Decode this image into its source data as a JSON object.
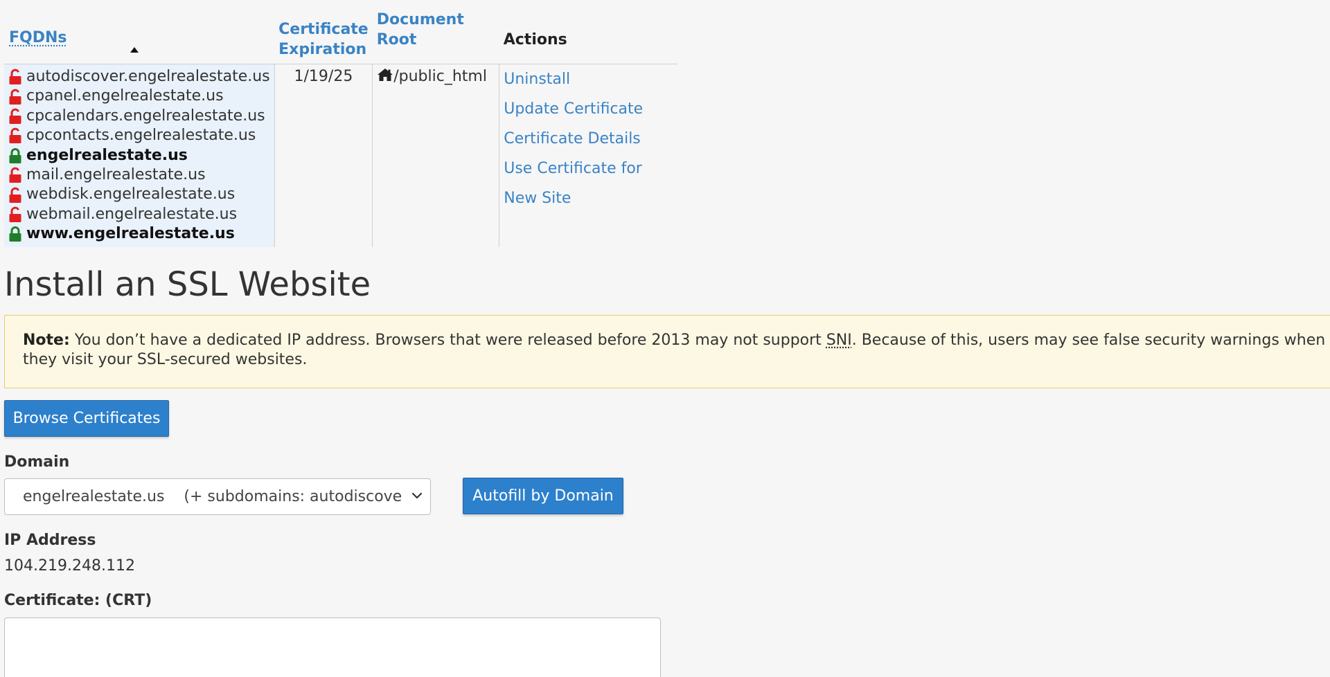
{
  "table": {
    "headers": {
      "fqdns": "FQDNs",
      "cert_expiration_line1": "Certificate",
      "cert_expiration_line2": "Expiration",
      "document_root": "Document Root",
      "actions": "Actions"
    },
    "row": {
      "fqdns": [
        {
          "name": "autodiscover.engelrealestate.us",
          "secure": false
        },
        {
          "name": "cpanel.engelrealestate.us",
          "secure": false
        },
        {
          "name": "cpcalendars.engelrealestate.us",
          "secure": false
        },
        {
          "name": "cpcontacts.engelrealestate.us",
          "secure": false
        },
        {
          "name": "engelrealestate.us",
          "secure": true
        },
        {
          "name": "mail.engelrealestate.us",
          "secure": false
        },
        {
          "name": "webdisk.engelrealestate.us",
          "secure": false
        },
        {
          "name": "webmail.engelrealestate.us",
          "secure": false
        },
        {
          "name": "www.engelrealestate.us",
          "secure": true
        }
      ],
      "expiration": "1/19/25",
      "document_root": "/public_html",
      "actions": [
        "Uninstall",
        "Update Certificate",
        "Certificate Details",
        "Use Certificate for New Site"
      ]
    }
  },
  "install": {
    "title": "Install an SSL Website",
    "note_label": "Note:",
    "note_text_1": " You don’t have a dedicated IP address. Browsers that were released before 2013 may not support ",
    "note_abbr": "SNI",
    "note_text_2": ". Because of this, users may see false security warnings when they visit your SSL-secured websites.",
    "browse_button": "Browse Certificates",
    "domain_label": "Domain",
    "domain_value": "engelrealestate.us    (+ subdomains: autodiscover, cp",
    "autofill_button": "Autofill by Domain",
    "ip_label": "IP Address",
    "ip_value": "104.219.248.112",
    "crt_label": "Certificate: (CRT)",
    "crt_value": ""
  },
  "colors": {
    "link": "#3a83c5",
    "button": "#2d80cc",
    "lock_insecure": "#e02020",
    "lock_secure": "#1e7f2a",
    "note_bg": "#fdf8e3",
    "fqdn_bg": "#e9f1fa"
  },
  "icons": {
    "insecure": "unlock-icon",
    "secure": "lock-icon",
    "home": "home-icon",
    "sort": "sort-ascending-icon",
    "dropdown": "chevron-down-icon"
  }
}
